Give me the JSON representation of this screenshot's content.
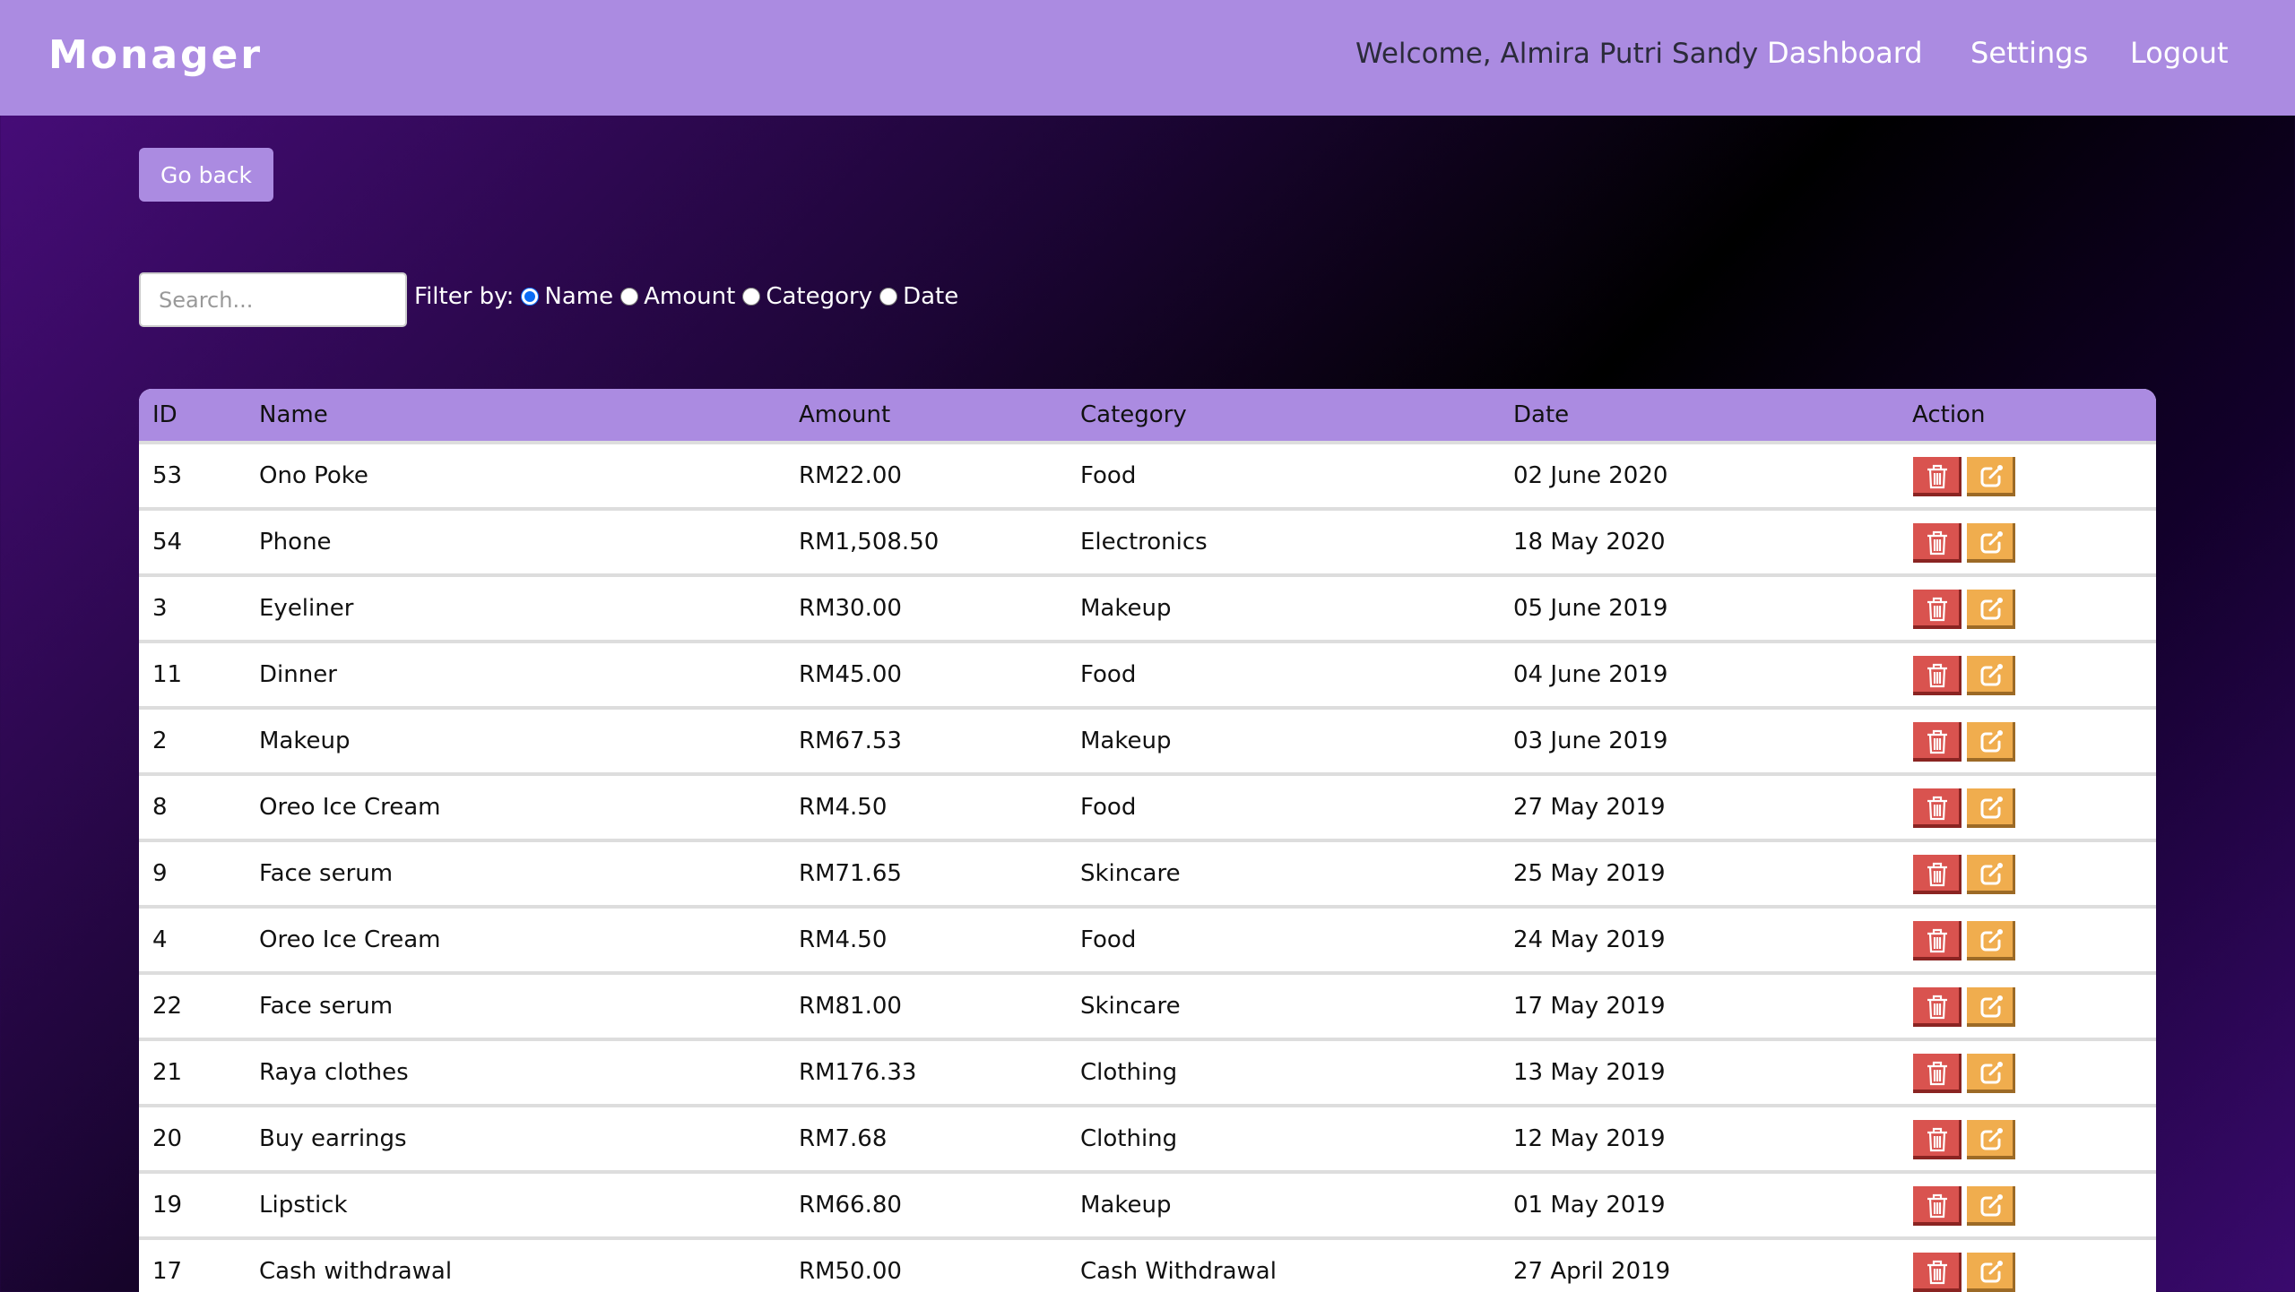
{
  "nav": {
    "logo": "Monager",
    "welcome": "Welcome, Almira Putri Sandy",
    "links": [
      "Dashboard",
      "Settings",
      "Logout"
    ]
  },
  "go_back": "Go back",
  "search": {
    "placeholder": "Search...",
    "value": ""
  },
  "filter": {
    "label": "Filter by:",
    "options": [
      "Name",
      "Amount",
      "Category",
      "Date"
    ],
    "selected": "Name"
  },
  "table": {
    "headers": [
      "ID",
      "Name",
      "Amount",
      "Category",
      "Date",
      "Action"
    ],
    "rows": [
      [
        "53",
        "Ono Poke",
        "RM22.00",
        "Food",
        "02 June 2020"
      ],
      [
        "54",
        "Phone",
        "RM1,508.50",
        "Electronics",
        "18 May 2020"
      ],
      [
        "3",
        "Eyeliner",
        "RM30.00",
        "Makeup",
        "05 June 2019"
      ],
      [
        "11",
        "Dinner",
        "RM45.00",
        "Food",
        "04 June 2019"
      ],
      [
        "2",
        "Makeup",
        "RM67.53",
        "Makeup",
        "03 June 2019"
      ],
      [
        "8",
        "Oreo Ice Cream",
        "RM4.50",
        "Food",
        "27 May 2019"
      ],
      [
        "9",
        "Face serum",
        "RM71.65",
        "Skincare",
        "25 May 2019"
      ],
      [
        "4",
        "Oreo Ice Cream",
        "RM4.50",
        "Food",
        "24 May 2019"
      ],
      [
        "22",
        "Face serum",
        "RM81.00",
        "Skincare",
        "17 May 2019"
      ],
      [
        "21",
        "Raya clothes",
        "RM176.33",
        "Clothing",
        "13 May 2019"
      ],
      [
        "20",
        "Buy earrings",
        "RM7.68",
        "Clothing",
        "12 May 2019"
      ],
      [
        "19",
        "Lipstick",
        "RM66.80",
        "Makeup",
        "01 May 2019"
      ],
      [
        "17",
        "Cash withdrawal",
        "RM50.00",
        "Cash Withdrawal",
        "27 April 2019"
      ]
    ]
  }
}
